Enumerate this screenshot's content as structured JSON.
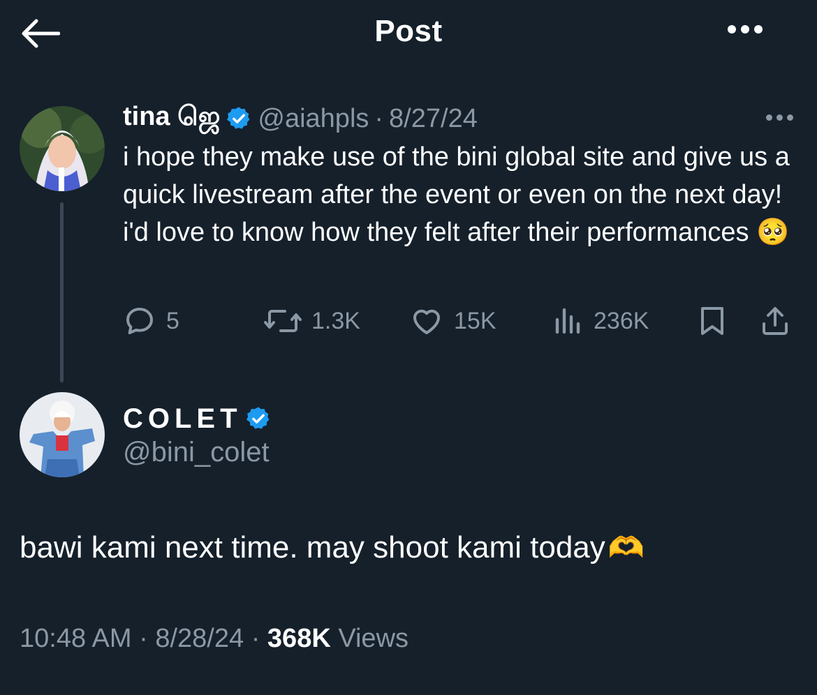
{
  "header": {
    "title": "Post"
  },
  "parent_tweet": {
    "display_name": "tina ஜெ",
    "handle": "@aiahpls",
    "separator": "·",
    "date": "8/27/24",
    "text": "i hope they make use of the bini global site and give us a quick livestream after the event or even on the next day! i'd love to know how they felt after their performances 🥺",
    "replies": "5",
    "reposts": "1.3K",
    "likes": "15K",
    "views": "236K"
  },
  "main_tweet": {
    "display_name": "COLET",
    "handle": "@bini_colet",
    "text": "bawi kami next time. may shoot kami today",
    "emoji": "🫶",
    "time": "10:48 AM",
    "sep1": "·",
    "date": "8/28/24",
    "sep2": "·",
    "views_count": "368K",
    "views_label": "Views"
  },
  "icons": {
    "back": "arrow-left-icon",
    "more": "more-horizontal-icon",
    "verified": "verified-badge-icon",
    "reply": "reply-icon",
    "repost": "repost-icon",
    "like": "heart-icon",
    "views": "views-chart-icon",
    "bookmark": "bookmark-icon",
    "share": "share-icon"
  },
  "colors": {
    "background": "#15202b",
    "text_primary": "#ffffff",
    "text_secondary": "#8b98a5",
    "verified": "#1d9bf0",
    "thread_line": "#3b4754"
  }
}
